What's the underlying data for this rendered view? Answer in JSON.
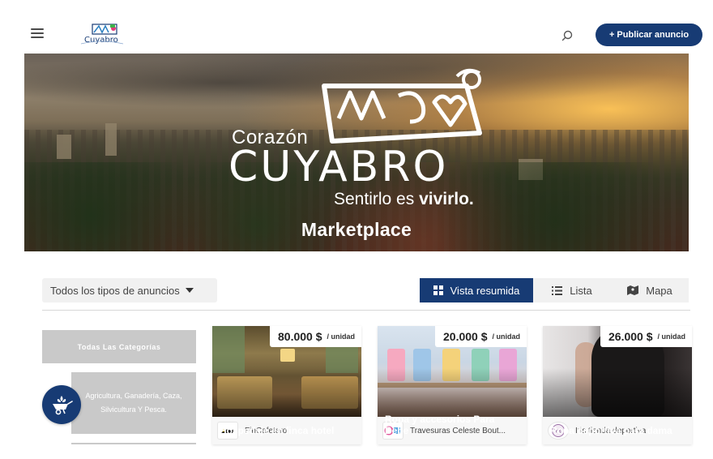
{
  "header": {
    "publish_label": "+ Publicar anuncio",
    "search_icon": "search-icon",
    "menu_icon": "hamburger-icon"
  },
  "hero": {
    "brand_pre": "Corazón",
    "brand_main": "CUYABRO",
    "brand_tag_prefix": "Sentirlo es ",
    "brand_tag_bold": "vivirlo.",
    "title": "Marketplace"
  },
  "toolbar": {
    "filter_label": "Todos los tipos de anuncios",
    "views": [
      {
        "label": "Vista resumida",
        "icon": "grid-icon",
        "active": true
      },
      {
        "label": "Lista",
        "icon": "list-icon",
        "active": false
      },
      {
        "label": "Mapa",
        "icon": "map-icon",
        "active": false
      }
    ]
  },
  "sidebar": {
    "all_categories": "Todas Las Categorías",
    "category_item": "Agricultura, Ganadería, Caza, Silvicultura Y Pesca.",
    "category_icon": "wheelbarrow-plant-icon"
  },
  "cards": [
    {
      "price": "80.000 $",
      "unit": "/ unidad",
      "title": "Hospedaje en finca hotel",
      "seller": "FinCafetero"
    },
    {
      "price": "20.000 $",
      "unit": "/ unidad",
      "title": "Ropa y accesorios Para Bebe",
      "seller": "Travesuras Celeste Bout..."
    },
    {
      "price": "26.000 $",
      "unit": "/ unidad",
      "title": "Ropa deportiva para dama",
      "seller": "Iris tienda deportiva"
    }
  ],
  "colors": {
    "primary": "#173b74",
    "chip_bg": "#f1f1f1",
    "category_bg": "#c9c9c9"
  }
}
